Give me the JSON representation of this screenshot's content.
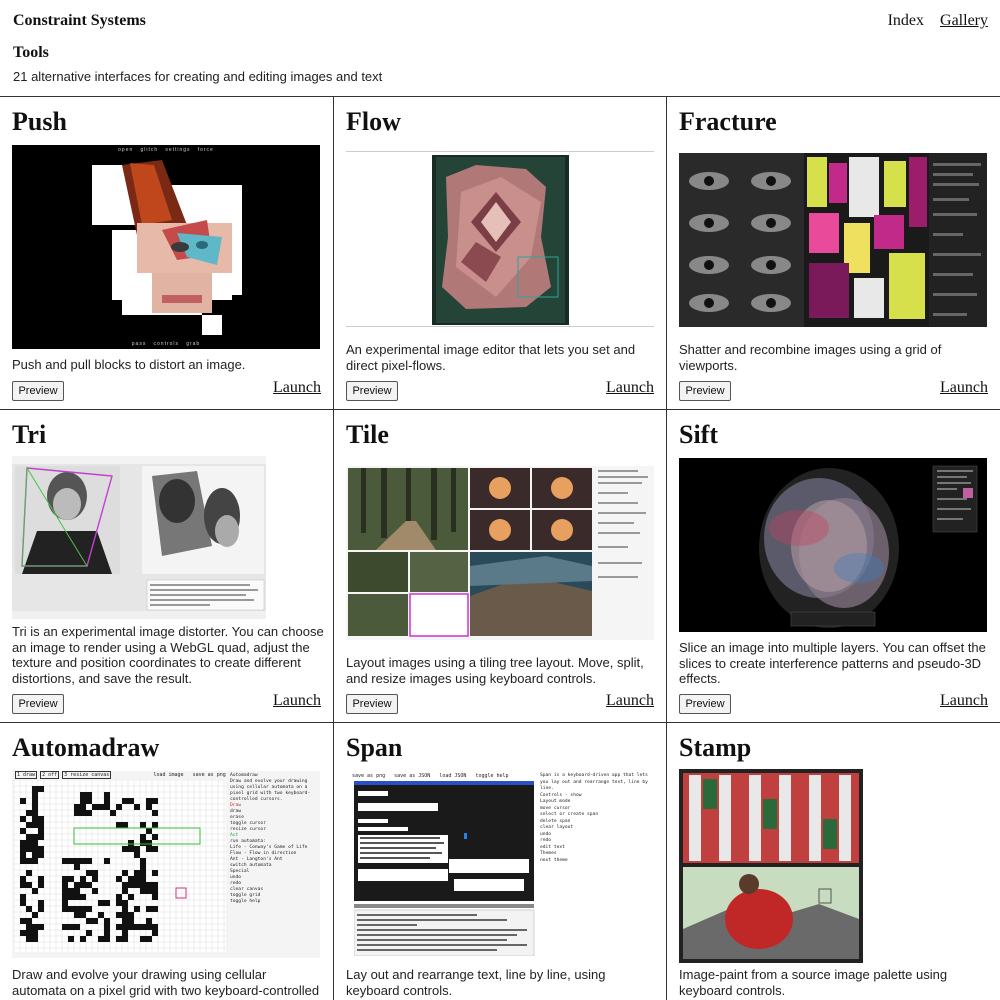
{
  "header": {
    "site_title": "Constraint Systems",
    "nav": [
      "Index",
      "Gallery"
    ],
    "section_title": "Tools",
    "section_subtitle": "21 alternative interfaces for creating and editing images and text"
  },
  "common": {
    "preview_label": "Preview",
    "launch_label": "Launch"
  },
  "tools": [
    {
      "name": "Push",
      "description": "Push and pull blocks to distort an image."
    },
    {
      "name": "Flow",
      "description": "An experimental image editor that lets you set and direct pixel-flows."
    },
    {
      "name": "Fracture",
      "description": "Shatter and recombine images using a grid of viewports."
    },
    {
      "name": "Tri",
      "description": "Tri is an experimental image distorter. You can choose an image to render using a WebGL quad, adjust the texture and position coordinates to create different distortions, and save the result."
    },
    {
      "name": "Tile",
      "description": "Layout images using a tiling tree layout. Move, split, and resize images using keyboard controls."
    },
    {
      "name": "Sift",
      "description": "Slice an image into multiple layers. You can offset the slices to create interference patterns and pseudo-3D effects."
    },
    {
      "name": "Automadraw",
      "description": "Draw and evolve your drawing using cellular automata on a pixel grid with two keyboard-controlled cursors."
    },
    {
      "name": "Span",
      "description": "Lay out and rearrange text, line by line, using keyboard controls."
    },
    {
      "name": "Stamp",
      "description": "Image-paint from a source image palette using keyboard controls."
    }
  ],
  "thumbs": {
    "push_menu": [
      "open",
      "glitch",
      "settings",
      "force"
    ],
    "push_footer": [
      "pass",
      "controls",
      "grab"
    ],
    "automadraw_toolbar": [
      "1 draw",
      "2 off",
      "3 resize canvas",
      "load image",
      "save as png"
    ],
    "automadraw_panel": [
      "Automadraw",
      "Draw and evolve your drawing using cellular automata on a pixel grid with two keyboard-controlled cursors.",
      "Draw",
      "draw",
      "erase",
      "toggle cursor",
      "resize cursor",
      "Act",
      "run automata:",
      "Life - Conway's Game of Life",
      "Flow - Flow in direction",
      "Ant - Langton's Ant",
      "switch automata",
      "Special",
      "undo",
      "redo",
      "clear canvas",
      "toggle grid",
      "toggle help"
    ],
    "span_toolbar": [
      "save as png",
      "save as JSON",
      "load JSON",
      "toggle help"
    ],
    "span_panel": [
      "Span is a keyboard-driven app that lets you lay out and rearrange text, line by line.",
      "Controls - show",
      "Layout mode",
      "move cursor",
      "select or create span",
      "delete span",
      "clear layout",
      "undo",
      "redo",
      "edit text",
      "Themes",
      "next theme"
    ]
  }
}
